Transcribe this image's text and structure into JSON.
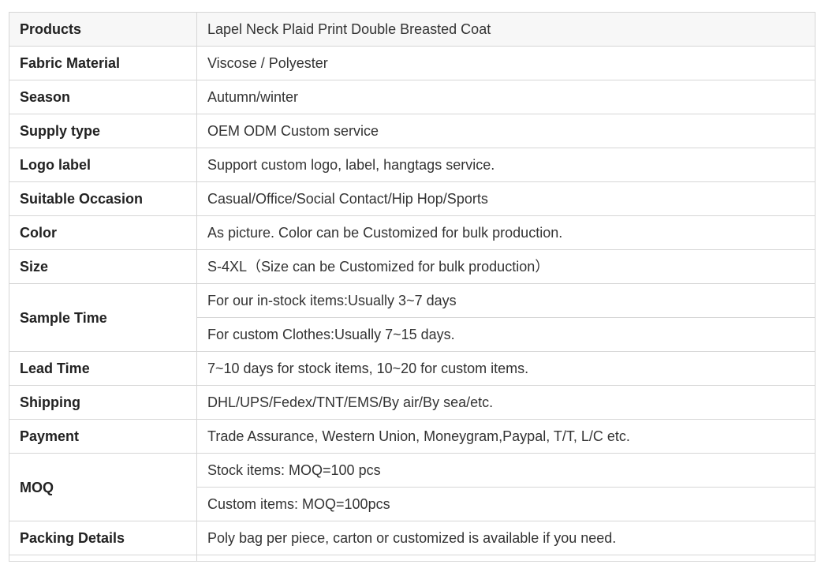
{
  "rows": [
    {
      "label": "Products",
      "values": [
        "Lapel Neck Plaid Print Double Breasted Coat"
      ],
      "shaded": true
    },
    {
      "label": "Fabric Material",
      "values": [
        "Viscose / Polyester"
      ]
    },
    {
      "label": "Season",
      "values": [
        "Autumn/winter"
      ]
    },
    {
      "label": "Supply type",
      "values": [
        "OEM ODM Custom service"
      ]
    },
    {
      "label": "Logo label",
      "values": [
        "Support custom logo, label, hangtags service."
      ]
    },
    {
      "label": "Suitable Occasion",
      "values": [
        "Casual/Office/Social Contact/Hip Hop/Sports"
      ]
    },
    {
      "label": "Color",
      "values": [
        "As picture. Color can be Customized for bulk production."
      ]
    },
    {
      "label": "Size",
      "values": [
        "S-4XL（Size can be Customized for bulk production）"
      ]
    },
    {
      "label": "Sample Time",
      "values": [
        "For our in-stock items:Usually 3~7 days",
        "For custom Clothes:Usually 7~15 days."
      ]
    },
    {
      "label": "Lead Time",
      "values": [
        "7~10 days for stock items, 10~20 for custom items."
      ]
    },
    {
      "label": "Shipping",
      "values": [
        "DHL/UPS/Fedex/TNT/EMS/By air/By sea/etc."
      ]
    },
    {
      "label": "Payment",
      "values": [
        "Trade Assurance, Western Union, Moneygram,Paypal, T/T, L/C etc."
      ]
    },
    {
      "label": "MOQ",
      "values": [
        "Stock items: MOQ=100 pcs",
        "Custom items: MOQ=100pcs"
      ]
    },
    {
      "label": "Packing Details",
      "values": [
        "Poly bag per piece, carton or customized is available if you need."
      ]
    }
  ]
}
